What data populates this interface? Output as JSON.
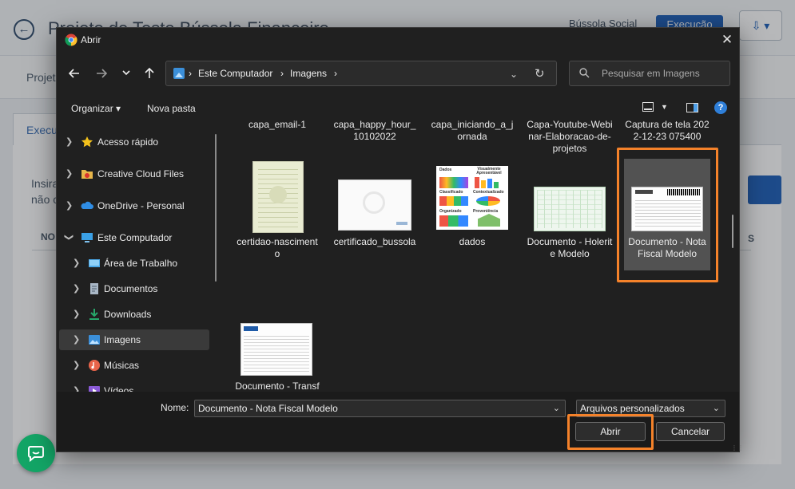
{
  "background": {
    "page_title": "Projeto de Teste Bússola Financeiro",
    "org": "Bússola Social",
    "status_badge": "Execução",
    "nav_text": "Projet",
    "tab_text": "Execu",
    "body_text_1": "Insira",
    "body_text_2": "não c",
    "col_left": "NO",
    "col_right": "S"
  },
  "dialog": {
    "title": "Abrir",
    "breadcrumb": [
      "Este Computador",
      "Imagens"
    ],
    "search_placeholder": "Pesquisar em Imagens",
    "toolbar": {
      "organize": "Organizar",
      "new_folder": "Nova pasta"
    },
    "nav_items": [
      {
        "label": "Acesso rápido",
        "icon": "star-icon"
      },
      {
        "label": "Creative Cloud Files",
        "icon": "creative-cloud-folder-icon"
      },
      {
        "label": "OneDrive - Personal",
        "icon": "onedrive-cloud-icon"
      },
      {
        "label": "Este Computador",
        "icon": "computer-icon"
      },
      {
        "label": "Área de Trabalho",
        "icon": "desktop-icon"
      },
      {
        "label": "Documentos",
        "icon": "documents-icon"
      },
      {
        "label": "Downloads",
        "icon": "download-icon"
      },
      {
        "label": "Imagens",
        "icon": "pictures-icon"
      },
      {
        "label": "Músicas",
        "icon": "music-icon"
      },
      {
        "label": "Vídeos",
        "icon": "videos-icon"
      }
    ],
    "files_top_row": [
      "capa_email-1",
      "capa_happy_hour_10102022",
      "capa_iniciando_a_jornada",
      "Capa-Youtube-Webinar-Elaboracao-de-projetos",
      "Captura de tela 2022-12-23 075400"
    ],
    "files": [
      "certidao-nascimento",
      "certificado_bussola",
      "dados",
      "Documento - Holerite Modelo",
      "Documento - Nota Fiscal Modelo",
      "Documento - Transferência - Modelo"
    ],
    "dados_thumb_labels": [
      "Dados",
      "Visualmente Apresentável",
      "Classificado",
      "Contextualizado",
      "Organizado",
      "Proveniência"
    ],
    "name_label": "Nome:",
    "file_name_value": "Documento - Nota Fiscal Modelo",
    "file_type": "Arquivos personalizados",
    "open_button": "Abrir",
    "cancel_button": "Cancelar",
    "highlight_color": "#f5822a",
    "selected_file": "Documento - Nota Fiscal Modelo"
  }
}
